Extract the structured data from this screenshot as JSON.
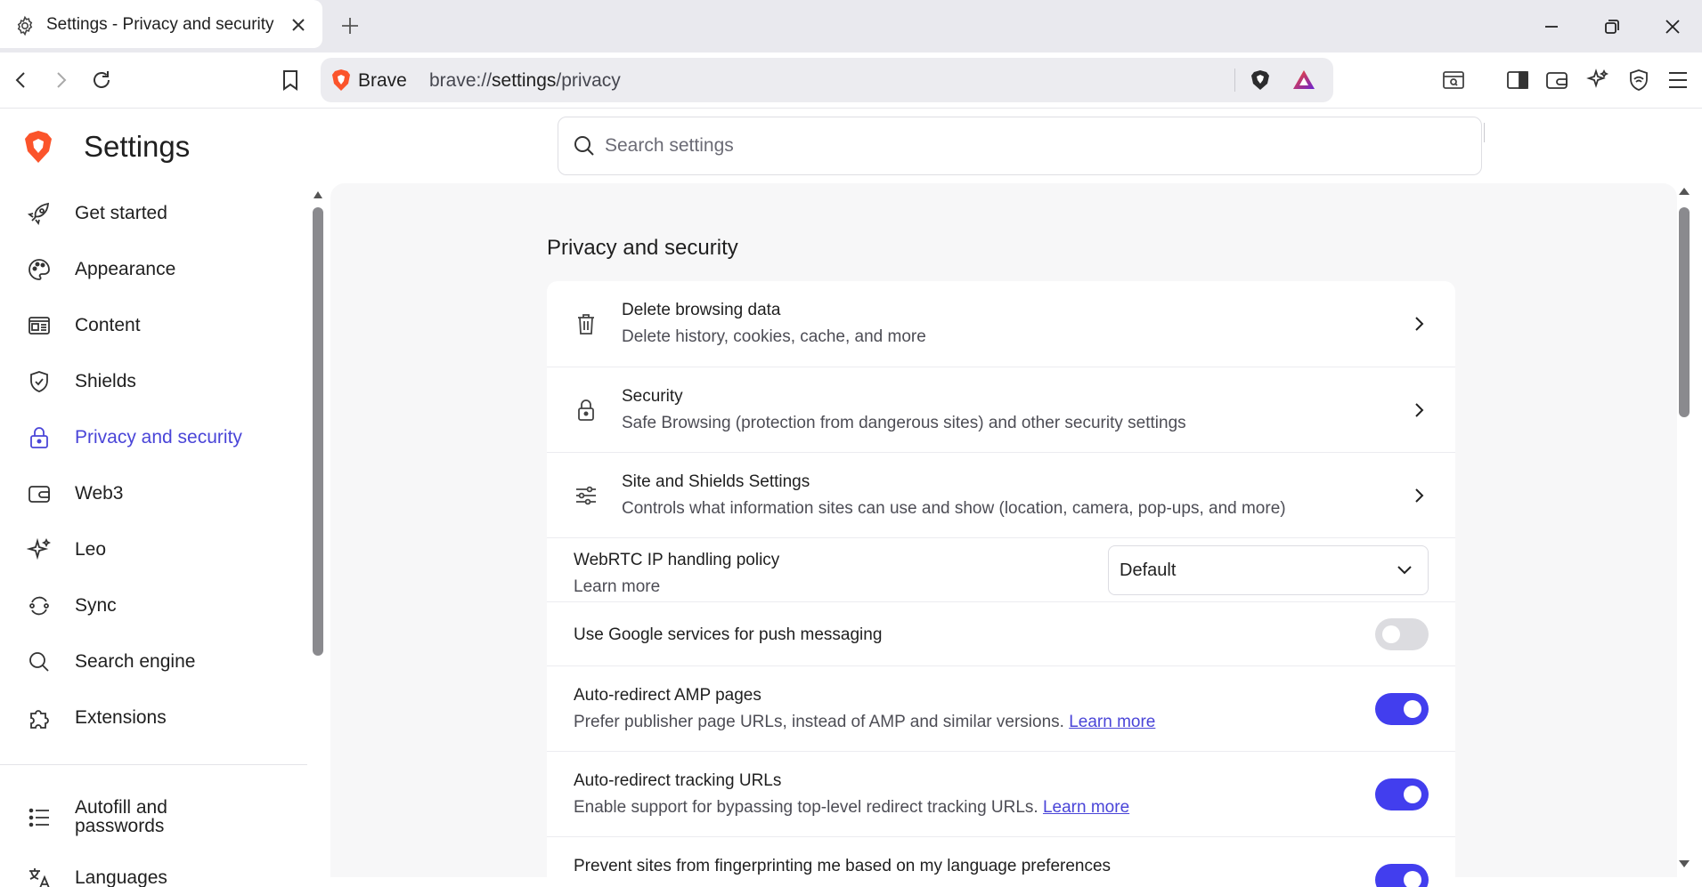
{
  "tab": {
    "title": "Settings - Privacy and security"
  },
  "omnibox": {
    "brand": "Brave",
    "url_host": "brave://",
    "url_path_bold": "settings",
    "url_rest": "/privacy"
  },
  "settings": {
    "title": "Settings",
    "search_placeholder": "Search settings"
  },
  "sidebar": {
    "items": [
      {
        "label": "Get started",
        "icon": "rocket-icon"
      },
      {
        "label": "Appearance",
        "icon": "palette-icon"
      },
      {
        "label": "Content",
        "icon": "content-icon"
      },
      {
        "label": "Shields",
        "icon": "shield-icon"
      },
      {
        "label": "Privacy and security",
        "icon": "lock-icon",
        "active": true
      },
      {
        "label": "Web3",
        "icon": "wallet-icon"
      },
      {
        "label": "Leo",
        "icon": "leo-icon"
      },
      {
        "label": "Sync",
        "icon": "sync-icon"
      },
      {
        "label": "Search engine",
        "icon": "search-icon"
      },
      {
        "label": "Extensions",
        "icon": "puzzle-icon"
      },
      {
        "label": "Autofill and passwords",
        "icon": "list-icon"
      },
      {
        "label": "Languages",
        "icon": "translate-icon"
      }
    ]
  },
  "section": {
    "title": "Privacy and security"
  },
  "rows": {
    "delete_data": {
      "title": "Delete browsing data",
      "sub": "Delete history, cookies, cache, and more"
    },
    "security": {
      "title": "Security",
      "sub": "Safe Browsing (protection from dangerous sites) and other security settings"
    },
    "site_shields": {
      "title": "Site and Shields Settings",
      "sub": "Controls what information sites can use and show (location, camera, pop-ups, and more)"
    },
    "webrtc": {
      "title": "WebRTC IP handling policy",
      "link": "Learn more",
      "select_value": "Default"
    },
    "push": {
      "title": "Use Google services for push messaging",
      "enabled": false
    },
    "amp": {
      "title": "Auto-redirect AMP pages",
      "sub": "Prefer publisher page URLs, instead of AMP and similar versions.",
      "link": "Learn more",
      "enabled": true
    },
    "tracking": {
      "title": "Auto-redirect tracking URLs",
      "sub": "Enable support for bypassing top-level redirect tracking URLs.",
      "link": "Learn more",
      "enabled": true
    },
    "fingerprint": {
      "title": "Prevent sites from fingerprinting me based on my language preferences",
      "enabled": true
    }
  },
  "colors": {
    "accent": "#423eee",
    "link": "#4a45d8",
    "brave_orange": "#fb542b"
  }
}
